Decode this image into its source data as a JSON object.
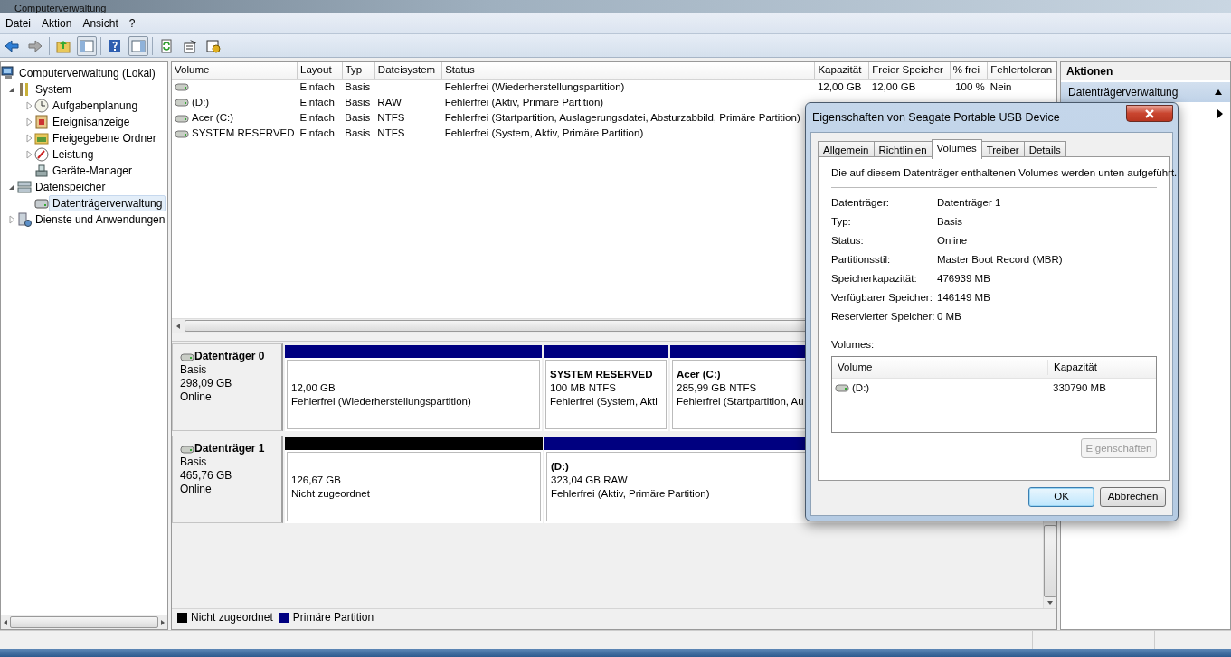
{
  "window": {
    "title": "Computerverwaltung"
  },
  "menu": [
    "Datei",
    "Aktion",
    "Ansicht",
    "?"
  ],
  "tree": [
    {
      "label": "Computerverwaltung (Lokal)",
      "kind": "computer",
      "selected": false,
      "children": [
        {
          "label": "System",
          "kind": "tools",
          "expanded": true,
          "selected": false,
          "children": [
            {
              "label": "Aufgabenplanung",
              "kind": "clock",
              "expanded": false,
              "selected": false
            },
            {
              "label": "Ereignisanzeige",
              "kind": "log",
              "expanded": false,
              "selected": false
            },
            {
              "label": "Freigegebene Ordner",
              "kind": "folder",
              "expanded": false,
              "selected": false
            },
            {
              "label": "Leistung",
              "kind": "gauge",
              "expanded": false,
              "selected": false
            },
            {
              "label": "Geräte-Manager",
              "kind": "device",
              "selected": false
            }
          ]
        },
        {
          "label": "Datenspeicher",
          "kind": "storage",
          "expanded": true,
          "selected": false,
          "children": [
            {
              "label": "Datenträgerverwaltung",
              "kind": "disk",
              "selected": true
            }
          ]
        },
        {
          "label": "Dienste und Anwendungen",
          "kind": "services",
          "expanded": false,
          "selected": false
        }
      ]
    }
  ],
  "table": {
    "columns": [
      "Volume",
      "Layout",
      "Typ",
      "Dateisystem",
      "Status",
      "Kapazität",
      "Freier Speicher",
      "% frei",
      "Fehlertoleran"
    ],
    "rows": [
      {
        "layout": "Einfach",
        "type": "Basis",
        "status": "Fehlerfrei (Wiederherstellungspartition)",
        "capacity": "12,00 GB",
        "free": "12,00 GB",
        "percent_free": "100 %",
        "fault_tolerance": "Nein"
      },
      {
        "volume": "(D:)",
        "layout": "Einfach",
        "type": "Basis",
        "filesystem": "RAW",
        "status": "Fehlerfrei (Aktiv, Primäre Partition)"
      },
      {
        "volume": "Acer (C:)",
        "layout": "Einfach",
        "type": "Basis",
        "filesystem": "NTFS",
        "status": "Fehlerfrei (Startpartition, Auslagerungsdatei, Absturzabbild, Primäre Partition)"
      },
      {
        "volume": "SYSTEM RESERVED",
        "layout": "Einfach",
        "type": "Basis",
        "filesystem": "NTFS",
        "status": "Fehlerfrei (System, Aktiv, Primäre Partition)"
      }
    ]
  },
  "disks": [
    {
      "name": "Datenträger 0",
      "type": "Basis",
      "size": "298,09 GB",
      "status": "Online",
      "partitions": [
        {
          "kind": "primary",
          "size": "12,00 GB",
          "status": "Fehlerfrei (Wiederherstellungspartition)"
        },
        {
          "kind": "primary",
          "title": "SYSTEM RESERVED",
          "size": "100 MB NTFS",
          "status": "Fehlerfrei (System, Akti"
        },
        {
          "kind": "primary",
          "title": "Acer  (C:)",
          "size": "285,99 GB NTFS",
          "status": "Fehlerfrei (Startpartition, Au"
        }
      ]
    },
    {
      "name": "Datenträger 1",
      "type": "Basis",
      "size": "465,76 GB",
      "status": "Online",
      "partitions": [
        {
          "kind": "unallocated",
          "size": "126,67 GB",
          "status": "Nicht zugeordnet"
        },
        {
          "kind": "primary",
          "title": "(D:)",
          "size": "323,04 GB RAW",
          "status": "Fehlerfrei (Aktiv, Primäre Partition)"
        }
      ]
    }
  ],
  "legend": [
    {
      "label": "Nicht zugeordnet",
      "color": "#000000"
    },
    {
      "label": "Primäre Partition",
      "color": "#000080"
    }
  ],
  "actions": {
    "title": "Aktionen",
    "items": [
      {
        "label": "Datenträgerverwaltung",
        "selected": true
      }
    ]
  },
  "dialog": {
    "title": "Eigenschaften von Seagate Portable USB Device",
    "tabs": [
      {
        "label": "Allgemein",
        "selected": false
      },
      {
        "label": "Richtlinien",
        "selected": false
      },
      {
        "label": "Volumes",
        "selected": true
      },
      {
        "label": "Treiber",
        "selected": false
      },
      {
        "label": "Details",
        "selected": false
      }
    ],
    "intro": "Die auf diesem Datenträger enthaltenen Volumes werden unten aufgeführt.",
    "fields": [
      {
        "label": "Datenträger:",
        "value": "Datenträger 1"
      },
      {
        "label": "Typ:",
        "value": "Basis"
      },
      {
        "label": "Status:",
        "value": "Online"
      },
      {
        "label": "Partitionsstil:",
        "value": "Master Boot Record (MBR)"
      },
      {
        "label": "Speicherkapazität:",
        "value": "476939 MB"
      },
      {
        "label": "Verfügbarer Speicher:",
        "value": "146149 MB"
      },
      {
        "label": "Reservierter Speicher:",
        "value": "0 MB"
      }
    ],
    "volumes_label": "Volumes:",
    "volumes_columns": [
      "Volume",
      "Kapazität"
    ],
    "volumes": [
      {
        "volume": "(D:)",
        "capacity": "330790 MB"
      }
    ],
    "properties_button": {
      "label": "Eigenschaften",
      "disabled": true
    },
    "buttons": [
      {
        "label": "OK",
        "focused": true
      },
      {
        "label": "Abbrechen",
        "focused": false
      }
    ]
  }
}
